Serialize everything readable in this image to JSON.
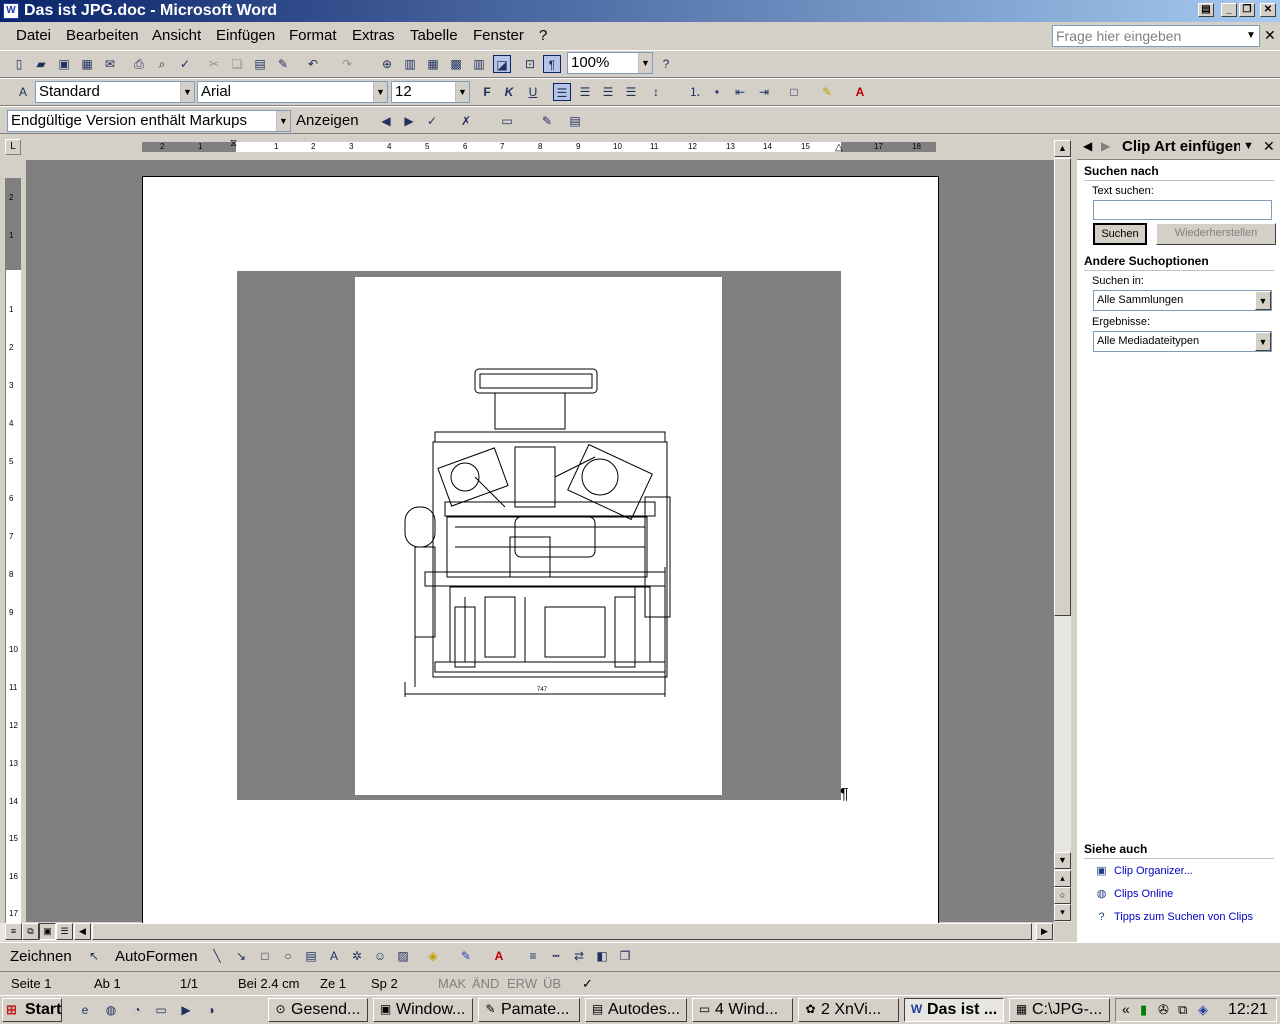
{
  "window": {
    "title": "Das ist JPG.doc - Microsoft Word",
    "app_icon": "W"
  },
  "menu": [
    "Datei",
    "Bearbeiten",
    "Ansicht",
    "Einfügen",
    "Format",
    "Extras",
    "Tabelle",
    "Fenster",
    "?"
  ],
  "help_box": {
    "placeholder": "Frage hier eingeben"
  },
  "standard_toolbar": {
    "zoom": "100%"
  },
  "format_toolbar": {
    "style": "Standard",
    "font": "Arial",
    "size": "12",
    "bold": "F",
    "italic": "K",
    "underline": "U"
  },
  "review_toolbar": {
    "view": "Endgültige Version enthält Markups",
    "show": "Anzeigen"
  },
  "ruler": {
    "numbers": [
      "2",
      "1",
      "1",
      "2",
      "3",
      "4",
      "5",
      "6",
      "7",
      "8",
      "9",
      "10",
      "11",
      "12",
      "13",
      "14",
      "15",
      "16",
      "17",
      "18"
    ],
    "vnumbers": [
      "2",
      "1",
      "1",
      "2",
      "3",
      "4",
      "5",
      "6",
      "7",
      "8",
      "9",
      "10",
      "11",
      "12",
      "13",
      "14",
      "15",
      "16",
      "17"
    ]
  },
  "document": {
    "dimension_label": "747",
    "pilcrow": "¶"
  },
  "task_pane": {
    "title": "Clip Art einfügen",
    "search_for": "Suchen nach",
    "text_search_label": "Text suchen:",
    "search_value": "",
    "search_button": "Suchen",
    "restore_button": "Wiederherstellen",
    "other_options": "Andere Suchoptionen",
    "search_in_label": "Suchen in:",
    "search_in_value": "Alle Sammlungen",
    "results_label": "Ergebnisse:",
    "results_value": "Alle Mediadateitypen",
    "see_also": "Siehe auch",
    "links": [
      "Clip Organizer...",
      "Clips Online",
      "Tipps zum Suchen von Clips"
    ]
  },
  "draw_toolbar": {
    "draw": "Zeichnen",
    "autoshapes": "AutoFormen"
  },
  "statusbar": {
    "page": "Seite 1",
    "section": "Ab 1",
    "pages": "1/1",
    "at": "Bei 2.4 cm",
    "line": "Ze 1",
    "col": "Sp 2",
    "mak": "MAK",
    "aend": "ÄND",
    "erw": "ERW",
    "ueb": "ÜB"
  },
  "taskbar": {
    "start": "Start",
    "buttons": [
      {
        "label": "Gesend...",
        "icon": "⊙"
      },
      {
        "label": "Window...",
        "icon": "▣"
      },
      {
        "label": "Pamate...",
        "icon": "✎"
      },
      {
        "label": "Autodes...",
        "icon": "▤"
      },
      {
        "label": "4 Wind...",
        "icon": "▭"
      },
      {
        "label": "2 XnVi...",
        "icon": "✿"
      },
      {
        "label": "Das ist ...",
        "icon": "W"
      },
      {
        "label": "C:\\JPG-...",
        "icon": "▦"
      }
    ],
    "clock": "12:21"
  },
  "colors": {
    "title_start": "#0a246a",
    "title_end": "#a6caf0",
    "link": "#0000c0"
  }
}
